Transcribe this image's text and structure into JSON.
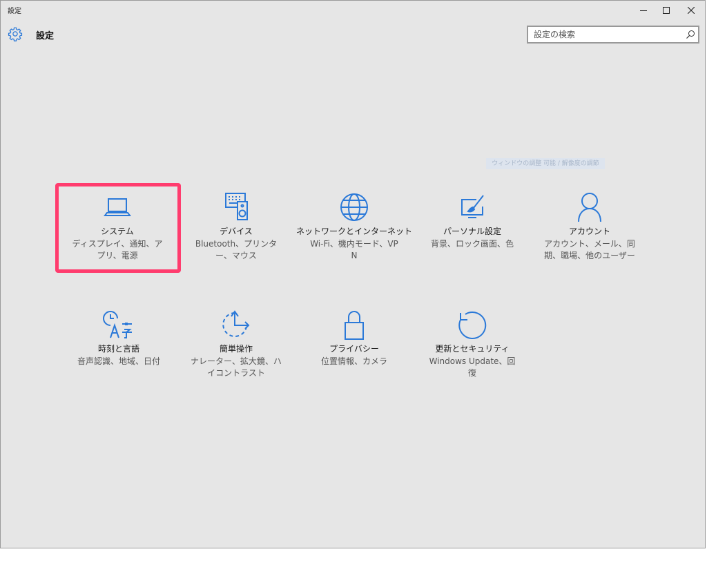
{
  "window": {
    "title": "設定"
  },
  "header": {
    "title": "設定"
  },
  "search": {
    "placeholder": "設定の検索",
    "value": ""
  },
  "watermark": {
    "text": "ウィンドウの調整 可能 / 解像度の調節"
  },
  "accent_color": "#2b79d8",
  "highlight_color": "#ff3c6e",
  "tiles": [
    {
      "label": "システム",
      "desc": "ディスプレイ、通知、アプリ、電源",
      "icon": "laptop-icon"
    },
    {
      "label": "デバイス",
      "desc": "Bluetooth、プリンター、マウス",
      "icon": "devices-icon"
    },
    {
      "label": "ネットワークとインターネット",
      "desc": "Wi-Fi、機内モード、VPN",
      "icon": "globe-icon"
    },
    {
      "label": "パーソナル設定",
      "desc": "背景、ロック画面、色",
      "icon": "personalization-icon"
    },
    {
      "label": "アカウント",
      "desc": "アカウント、メール、同期、職場、他のユーザー",
      "icon": "person-icon"
    },
    {
      "label": "時刻と言語",
      "desc": "音声認識、地域、日付",
      "icon": "time-language-icon"
    },
    {
      "label": "簡単操作",
      "desc": "ナレーター、拡大鏡、ハイコントラスト",
      "icon": "ease-of-access-icon"
    },
    {
      "label": "プライバシー",
      "desc": "位置情報、カメラ",
      "icon": "lock-icon"
    },
    {
      "label": "更新とセキュリティ",
      "desc": "Windows Update、回復",
      "icon": "update-icon"
    }
  ]
}
